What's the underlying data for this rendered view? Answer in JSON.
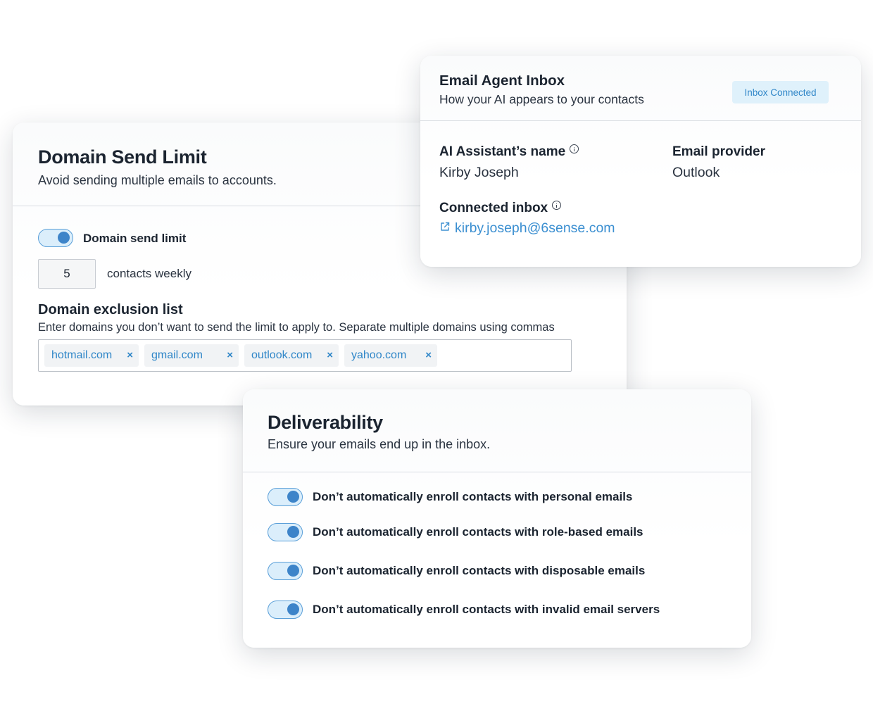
{
  "domain_send_limit": {
    "title": "Domain Send Limit",
    "subtitle": "Avoid sending multiple emails to accounts.",
    "toggle_label": "Domain send limit",
    "toggle_on": true,
    "limit_value": "5",
    "limit_unit": "contacts weekly",
    "exclusion_title": "Domain exclusion list",
    "exclusion_help": "Enter domains you don’t want to send the limit to apply to. Separate multiple domains using commas",
    "tags": [
      "hotmail.com",
      "gmail.com",
      "outlook.com",
      "yahoo.com"
    ],
    "tag_remove_symbol": "×"
  },
  "email_agent_inbox": {
    "title": "Email Agent Inbox",
    "subtitle": "How your AI appears to your contacts",
    "badge": "Inbox Connected",
    "ai_name_label": "AI Assistant’s name",
    "ai_name_value": "Kirby Joseph",
    "provider_label": "Email provider",
    "provider_value": "Outlook",
    "connected_label": "Connected inbox",
    "connected_email": "kirby.joseph@6sense.com"
  },
  "deliverability": {
    "title": "Deliverability",
    "subtitle": "Ensure your emails end up in the inbox.",
    "options": [
      {
        "label": "Don’t automatically enroll contacts with personal emails",
        "on": true
      },
      {
        "label": "Don’t automatically enroll contacts with role-based emails",
        "on": true
      },
      {
        "label": "Don’t automatically enroll contacts with disposable emails",
        "on": true
      },
      {
        "label": "Don’t automatically enroll contacts with invalid email servers",
        "on": true
      }
    ]
  },
  "colors": {
    "accent": "#3d84c9",
    "toggle_track": "#dbeefb",
    "link": "#3b8fd1",
    "badge_bg": "#dff1fb",
    "heading": "#1b2430"
  }
}
